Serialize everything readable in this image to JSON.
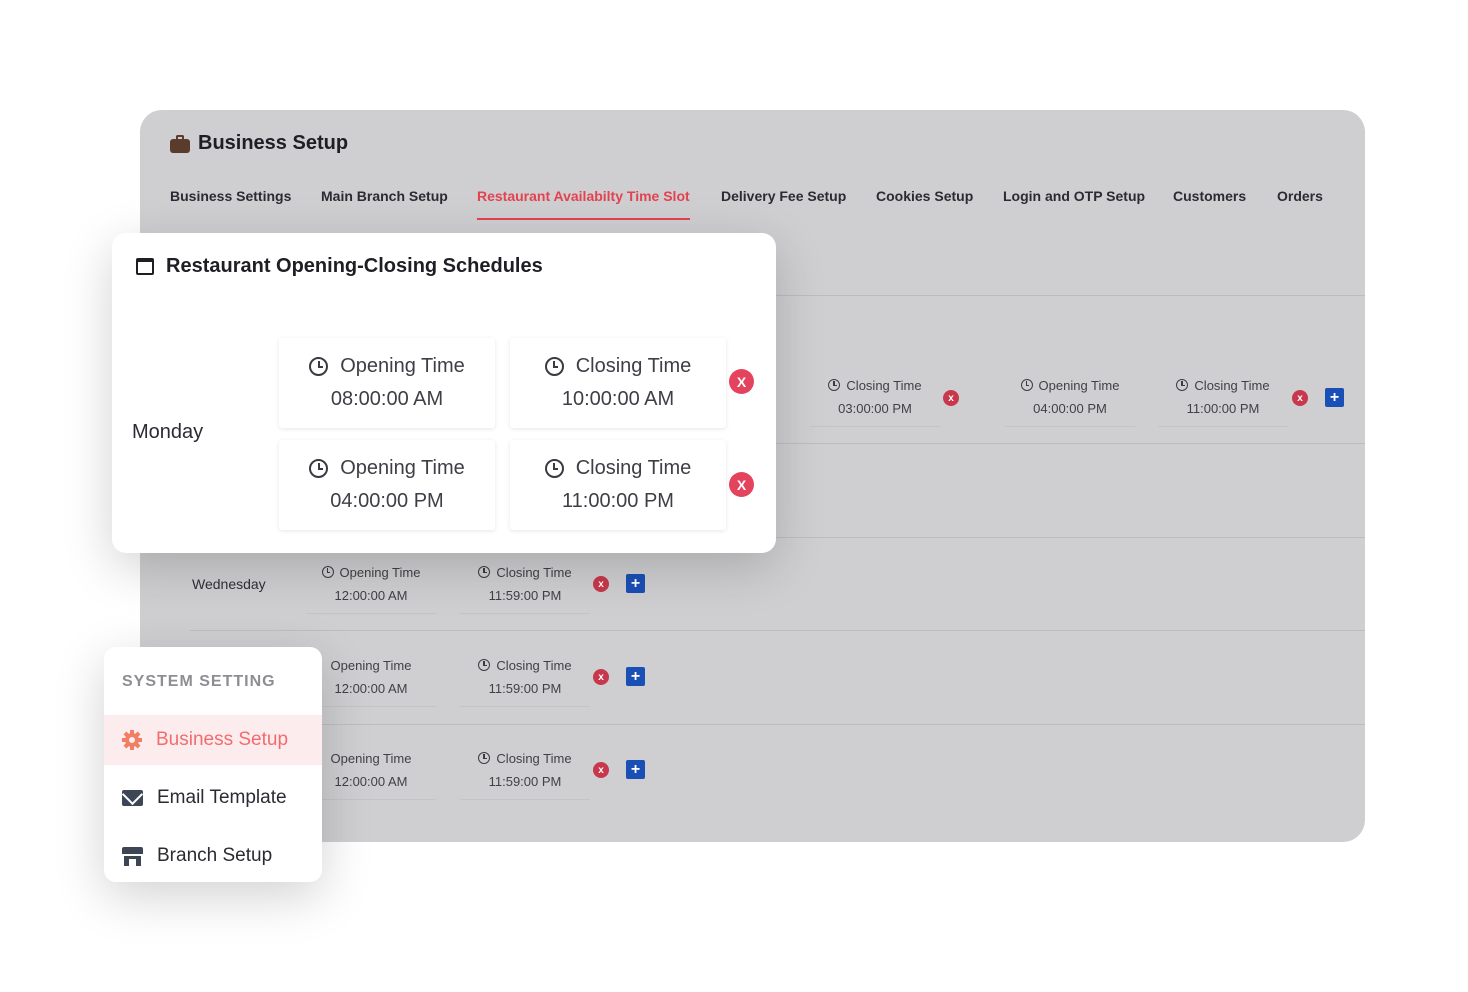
{
  "panel": {
    "title": "Business Setup",
    "tabs": [
      {
        "label": "Business Settings"
      },
      {
        "label": "Main Branch Setup"
      },
      {
        "label": "Restaurant Availabilty Time Slot"
      },
      {
        "label": "Delivery Fee Setup"
      },
      {
        "label": "Cookies Setup"
      },
      {
        "label": "Login and OTP Setup"
      },
      {
        "label": "Customers"
      },
      {
        "label": "Orders"
      }
    ],
    "active_tab_index": 2,
    "monday_extra": [
      {
        "label": "Closing Time",
        "time": "03:00:00 PM"
      },
      {
        "label": "Opening Time",
        "time": "04:00:00 PM"
      },
      {
        "label": "Closing Time",
        "time": "11:00:00 PM"
      }
    ],
    "rows": [
      {
        "day": "Wednesday",
        "open_label": "Opening Time",
        "open_time": "12:00:00 AM",
        "close_label": "Closing Time",
        "close_time": "11:59:00 PM"
      },
      {
        "day": "",
        "open_label": "Opening Time",
        "open_time": "12:00:00 AM",
        "close_label": "Closing Time",
        "close_time": "11:59:00 PM"
      },
      {
        "day": "",
        "open_label": "Opening Time",
        "open_time": "12:00:00 AM",
        "close_label": "Closing Time",
        "close_time": "11:59:00 PM"
      }
    ],
    "remove_glyph": "x",
    "add_glyph": "+"
  },
  "schedule_card": {
    "title": "Restaurant Opening-Closing Schedules",
    "day": "Monday",
    "slots": [
      {
        "open_label": "Opening Time",
        "open_time": "08:00:00 AM",
        "close_label": "Closing Time",
        "close_time": "10:00:00 AM"
      },
      {
        "open_label": "Opening Time",
        "open_time": "04:00:00 PM",
        "close_label": "Closing Time",
        "close_time": "11:00:00 PM"
      }
    ],
    "remove_glyph": "X"
  },
  "system_menu": {
    "heading": "SYSTEM SETTING",
    "items": [
      {
        "label": "Business Setup",
        "icon": "gear-icon",
        "active": true
      },
      {
        "label": "Email Template",
        "icon": "mail-icon",
        "active": false
      },
      {
        "label": "Branch Setup",
        "icon": "store-icon",
        "active": false
      }
    ],
    "colors": {
      "active_text": "#f26c6f",
      "active_bg": "#fdeced"
    }
  },
  "colors": {
    "accent": "#e3434f",
    "remove": "#c8384c",
    "add": "#1a4fb5",
    "panel_bg": "#cfcfd1"
  }
}
